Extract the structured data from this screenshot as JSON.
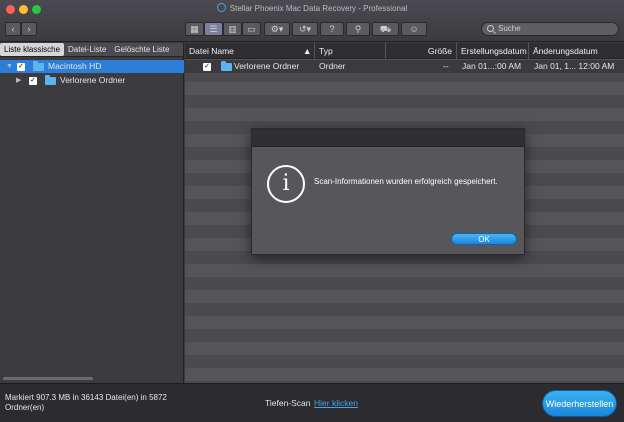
{
  "window": {
    "title": "Stellar Phoenix Mac Data Recovery - Professional"
  },
  "toolbar": {
    "back_icon": "chevron-left-icon",
    "forward_icon": "chevron-right-icon",
    "views": [
      "icon-view",
      "list-view",
      "column-view",
      "coverflow-view"
    ],
    "active_view_index": 1,
    "tools": [
      "gear-icon",
      "history-icon",
      "help-icon",
      "scan-icon",
      "cart-icon",
      "user-icon"
    ],
    "search_placeholder": "Suche"
  },
  "left_pane": {
    "tabs": [
      "Liste klassische",
      "Datei-Liste",
      "Gelöschte Liste"
    ],
    "active_tab_index": 0,
    "tree": [
      {
        "label": "Macintosh HD",
        "checked": true,
        "selected": true
      },
      {
        "label": "Verlorene Ordner",
        "checked": true,
        "selected": false
      }
    ]
  },
  "file_list": {
    "columns": [
      "Datei Name",
      "Typ",
      "Größe",
      "Erstellungsdatum",
      "Änderungsdatum"
    ],
    "sort_indicator": "▲",
    "rows": [
      {
        "name": "Verlorene Ordner",
        "type": "Ordner",
        "size": "--",
        "created": "Jan 01...:00 AM",
        "modified": "Jan 01, 1... 12:00 AM",
        "checked": true
      }
    ]
  },
  "status": {
    "text": "Markiert 907.3 MB in 36143 Datei(en) in 5872 Ordner(en)",
    "deep_scan_label": "Tiefen-Scan",
    "deep_scan_link": "Hier klicken",
    "recover_button": "Wiederherstellen"
  },
  "dialog": {
    "icon": "info-icon",
    "message": "Scan-Informationen wurden erfolgreich gespeichert.",
    "ok_label": "OK"
  },
  "colors": {
    "accent": "#2c7ed6",
    "link": "#4aa3e8",
    "folder": "#5bb3f0"
  }
}
